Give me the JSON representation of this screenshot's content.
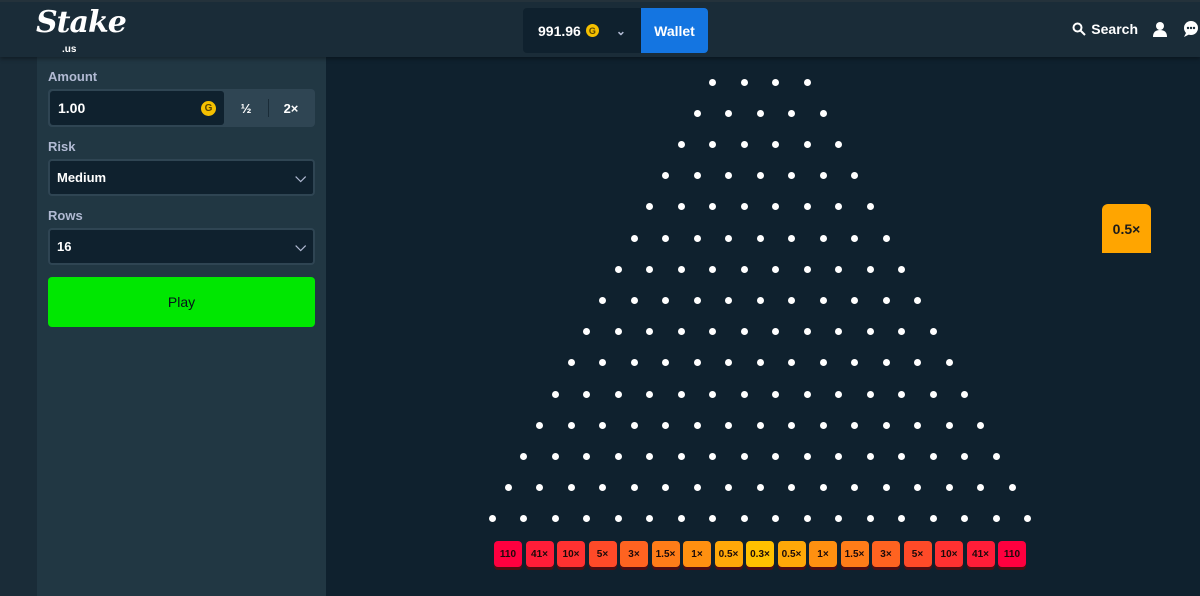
{
  "header": {
    "logo": "Stake",
    "logo_suffix": ".us",
    "balance": "991.96",
    "currency_icon": "G",
    "wallet_label": "Wallet",
    "search_label": "Search"
  },
  "sidebar": {
    "amount_label": "Amount",
    "amount_value": "1.00",
    "half_label": "½",
    "double_label": "2×",
    "risk_label": "Risk",
    "risk_value": "Medium",
    "rows_label": "Rows",
    "rows_value": "16",
    "play_label": "Play"
  },
  "board": {
    "multipliers": [
      "110",
      "41×",
      "10×",
      "5×",
      "3×",
      "1.5×",
      "1×",
      "0.5×",
      "0.3×",
      "0.5×",
      "1×",
      "1.5×",
      "3×",
      "5×",
      "10×",
      "41×",
      "110"
    ],
    "colors": [
      "#ff003f",
      "#ff1d38",
      "#ff3131",
      "#ff4a28",
      "#ff6320",
      "#ff7c18",
      "#ff9010",
      "#ffa808",
      "#ffc000",
      "#ffa808",
      "#ff9010",
      "#ff7c18",
      "#ff6320",
      "#ff4a28",
      "#ff3131",
      "#ff1d38",
      "#ff003f"
    ],
    "last_result": "0.5×"
  }
}
